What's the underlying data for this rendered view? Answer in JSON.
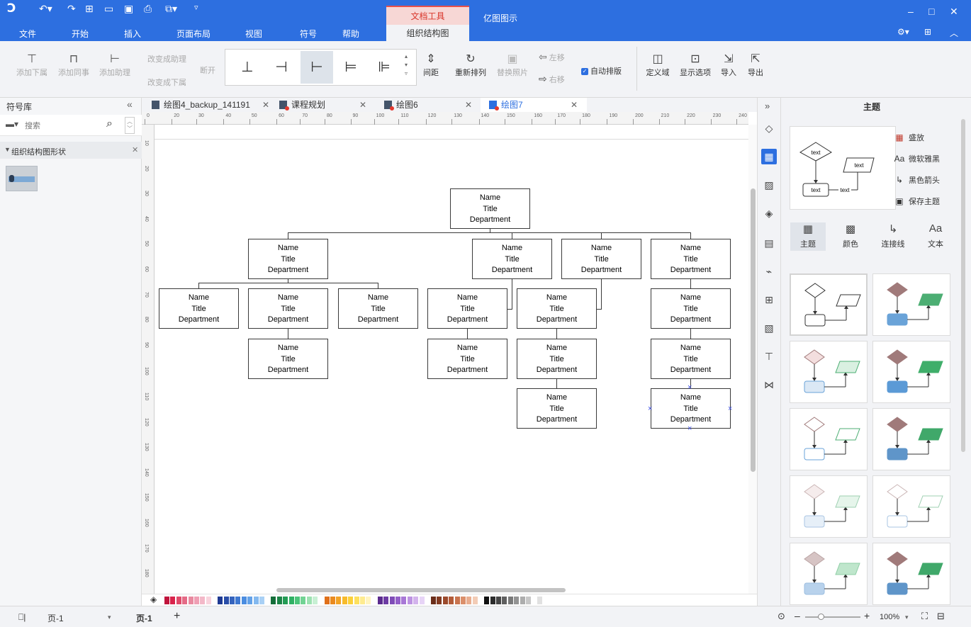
{
  "titlebar": {
    "doc_tools_tab": "文档工具",
    "org_chart_tab": "组织结构图",
    "app_label": "亿图图示"
  },
  "menu": [
    "文件",
    "开始",
    "插入",
    "页面布局",
    "视图",
    "符号",
    "帮助"
  ],
  "ribbon": {
    "add_subordinate": "添加下属",
    "add_colleague": "添加同事",
    "add_assistant": "添加助理",
    "change_to_assistant": "改变成助理",
    "change_to_subordinate": "改变成下属",
    "break_off": "断开",
    "spacing": "间距",
    "rearrange": "重新排列",
    "replace_photo": "替换照片",
    "move_left": "左移",
    "move_right": "右移",
    "auto_layout": "自动排版",
    "auto_layout_checked": true,
    "define_field": "定义域",
    "display_options": "显示选项",
    "import": "导入",
    "export": "导出"
  },
  "left_panel": {
    "title": "符号库",
    "search_placeholder": "搜索",
    "category": "组织结构图形状"
  },
  "tabs": [
    {
      "label": "绘图4_backup_141191",
      "active": false
    },
    {
      "label": "课程规划",
      "active": false
    },
    {
      "label": "绘图6",
      "active": false
    },
    {
      "label": "绘图7",
      "active": true
    }
  ],
  "ruler": {
    "top": [
      "0",
      "20",
      "30",
      "40",
      "50",
      "60",
      "70",
      "80",
      "90",
      "100",
      "110",
      "120",
      "130",
      "140",
      "150",
      "160",
      "170",
      "180",
      "190",
      "200",
      "210",
      "220",
      "230",
      "240"
    ],
    "left": [
      "10",
      "20",
      "30",
      "40",
      "50",
      "60",
      "70",
      "80",
      "90",
      "100",
      "110",
      "120",
      "130",
      "140",
      "150",
      "160",
      "170",
      "180"
    ]
  },
  "org_node": {
    "name": "Name",
    "title": "Title",
    "dept": "Department"
  },
  "right_panel": {
    "title": "主题",
    "preview_text": "text",
    "props": [
      "盛放",
      "微软雅黑",
      "黑色箭头",
      "保存主题"
    ],
    "tabs": [
      "主题",
      "颜色",
      "连接线",
      "文本"
    ]
  },
  "status": {
    "page_dropdown": "页-1",
    "page_tab": "页-1",
    "add_page": "+",
    "zoom": "100%"
  },
  "colors": {
    "accent": "#2d6fe0",
    "doc_tools_red": "#d9362b",
    "theme_diamond_light": "#a07a7a",
    "theme_box_blue": "#6aa3d8",
    "theme_para_green": "#4cae73"
  }
}
